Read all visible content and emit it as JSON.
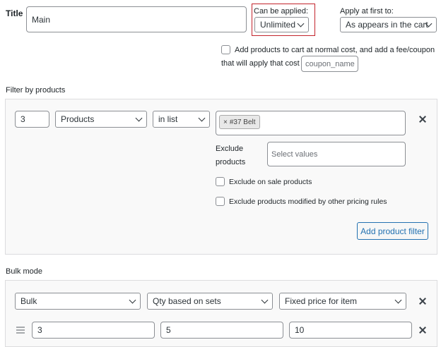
{
  "rule": {
    "title_label": "Title",
    "title_value": "Main",
    "can_be_applied_label": "Can be applied:",
    "can_be_applied_value": "Unlimited",
    "apply_first_label": "Apply at first to:",
    "apply_first_value": "As appears in the cart",
    "add_products_text": "Add products to cart at normal cost, and add a fee/coupon",
    "coupon_text": "that will apply that cost",
    "coupon_placeholder": "coupon_name",
    "highlight_color": "#c3242c"
  },
  "filter": {
    "section_label": "Filter by products",
    "qty": "3",
    "type": "Products",
    "method": "in list",
    "tags": [
      {
        "remove": "×",
        "label": "#37 Belt"
      }
    ],
    "exclude_label_1": "Exclude",
    "exclude_label_2": "products",
    "exclude_placeholder": "Select values",
    "exclude_on_sale": "Exclude on sale products",
    "exclude_modified": "Exclude products modified by other pricing rules",
    "add_button": "Add product filter"
  },
  "bulk": {
    "section_label": "Bulk mode",
    "mode": "Bulk",
    "qty_based": "Qty based on sets",
    "price_type": "Fixed price for item",
    "range_from": "3",
    "range_to": "5",
    "range_value": "10"
  }
}
